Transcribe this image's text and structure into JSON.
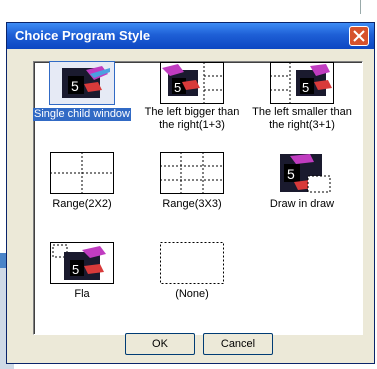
{
  "dialog": {
    "title": "Choice Program Style",
    "ok_label": "OK",
    "cancel_label": "Cancel"
  },
  "styles": [
    {
      "label": "Single child window",
      "selected": true
    },
    {
      "label": "The left bigger than the right(1+3)",
      "line1": "The left bigger than",
      "line2": "the right(1+3)"
    },
    {
      "label": "The left smaller than the right(3+1)",
      "line1": "The left smaller than",
      "line2": "the right(3+1)"
    },
    {
      "label": "Range(2X2)"
    },
    {
      "label": "Range(3X3)"
    },
    {
      "label": "Draw in draw"
    },
    {
      "label": "Fla"
    },
    {
      "label": "(None)"
    }
  ],
  "colors": {
    "titlebar": "#1e5fd6",
    "selection": "#316ac5",
    "dialog_bg": "#ece9d8"
  }
}
